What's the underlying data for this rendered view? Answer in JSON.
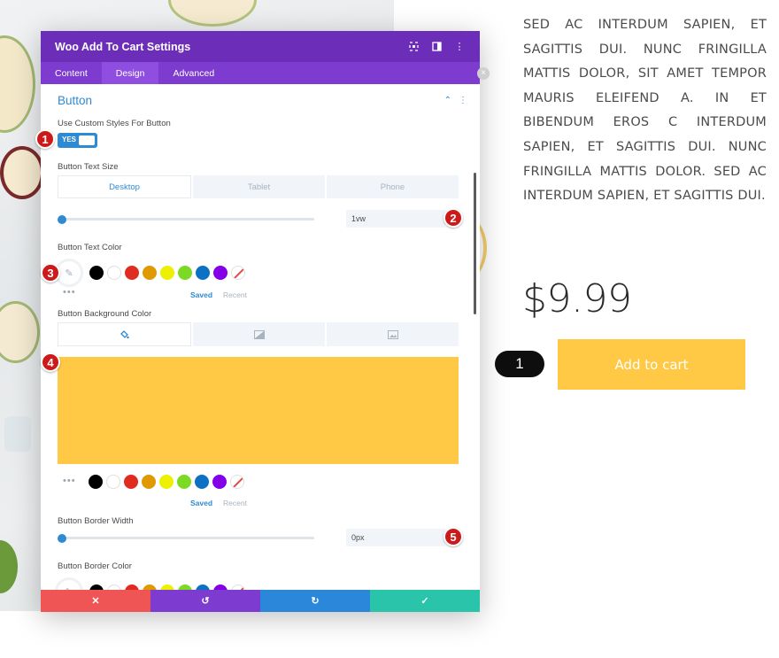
{
  "page": {
    "description": "Sed ac interdum sapien, et sagittis dui. Nunc fringilla mattis dolor, sit amet tempor mauris eleifend a. In et bibendum eros c interdum sapien, et sagittis dui. Nunc fringilla mattis dolor. Sed ac interdum sapien, et sagittis dui.",
    "price": "$9.99",
    "quantity": "1",
    "add_to_cart": "Add to cart"
  },
  "modal": {
    "title": "Woo Add To Cart Settings",
    "tabs": [
      "Content",
      "Design",
      "Advanced"
    ],
    "active_tab": "Design",
    "section_title": "Button",
    "custom_styles_label": "Use Custom Styles For Button",
    "toggle_label": "YES",
    "text_size_label": "Button Text Size",
    "device_tabs": [
      "Desktop",
      "Tablet",
      "Phone"
    ],
    "text_size_value": "1vw",
    "text_color_label": "Button Text Color",
    "saved_label": "Saved",
    "recent_label": "Recent",
    "bg_color_label": "Button Background Color",
    "border_width_label": "Button Border Width",
    "border_width_value": "0px",
    "border_color_label": "Button Border Color"
  },
  "colors": {
    "accent": "#2e8ad3",
    "header": "#6c2eb9",
    "bg_preview": "#ffc845",
    "swatches": [
      "#000000",
      "#ffffff",
      "#e02b20",
      "#e09900",
      "#edf000",
      "#7cda24",
      "#0c71c3",
      "#8300e9"
    ]
  },
  "markers": [
    "1",
    "2",
    "3",
    "4",
    "5"
  ],
  "footer": {
    "icons": [
      "close-icon",
      "undo-icon",
      "redo-icon",
      "check-icon"
    ]
  }
}
